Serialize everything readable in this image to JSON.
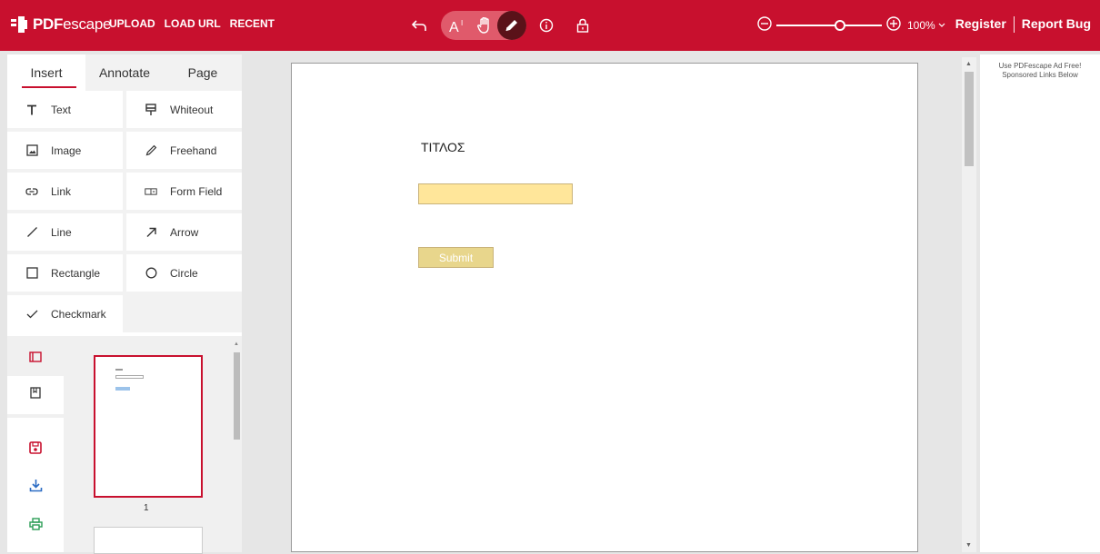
{
  "brand": {
    "name_a": "PDF",
    "name_b": "escape",
    "color": "#c8102e"
  },
  "topnav": [
    "UPLOAD",
    "LOAD URL",
    "RECENT"
  ],
  "toolbar": {
    "icons": [
      "undo-icon",
      "text-select-icon",
      "hand-icon",
      "pencil-icon",
      "info-icon",
      "lock-icon"
    ],
    "active": "pencil-icon"
  },
  "zoom": {
    "level": "100%",
    "slider_fraction": 0.55
  },
  "header_links": {
    "register": "Register",
    "report_bug": "Report Bug"
  },
  "left_tabs": [
    {
      "label": "Insert"
    },
    {
      "label": "Annotate"
    },
    {
      "label": "Page"
    }
  ],
  "insert_tools": [
    {
      "label": "Text",
      "icon": "text-icon"
    },
    {
      "label": "Whiteout",
      "icon": "whiteout-icon"
    },
    {
      "label": "Image",
      "icon": "image-icon"
    },
    {
      "label": "Freehand",
      "icon": "freehand-icon"
    },
    {
      "label": "Link",
      "icon": "link-icon"
    },
    {
      "label": "Form Field",
      "icon": "form-field-icon"
    },
    {
      "label": "Line",
      "icon": "line-icon"
    },
    {
      "label": "Arrow",
      "icon": "arrow-icon"
    },
    {
      "label": "Rectangle",
      "icon": "rectangle-icon"
    },
    {
      "label": "Circle",
      "icon": "circle-icon"
    },
    {
      "label": "Checkmark",
      "icon": "checkmark-icon"
    }
  ],
  "thumbnails": {
    "page_number": "1"
  },
  "document": {
    "title": "ΤΙΤΛΟΣ",
    "submit_label": "Submit"
  },
  "ad": {
    "line1": "Use PDFescape Ad Free!",
    "line2": "Sponsored Links Below"
  }
}
